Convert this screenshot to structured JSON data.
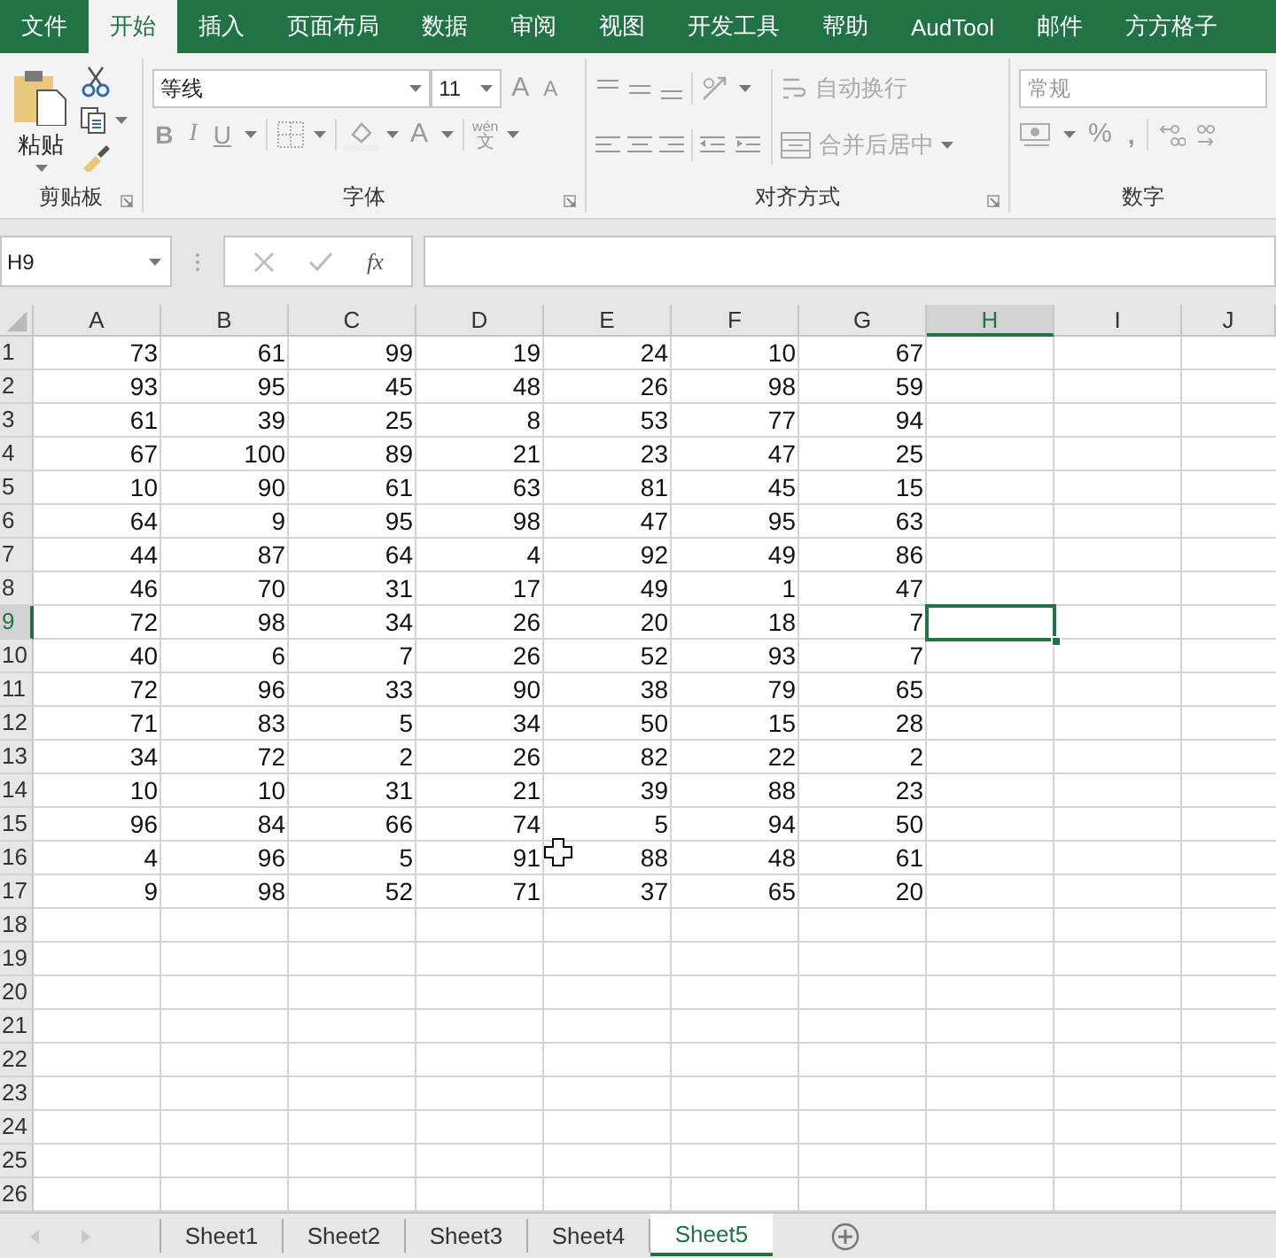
{
  "menu_tabs": [
    {
      "label": "文件",
      "selected": false
    },
    {
      "label": "开始",
      "selected": true
    },
    {
      "label": "插入",
      "selected": false
    },
    {
      "label": "页面布局",
      "selected": false
    },
    {
      "label": "数据",
      "selected": false
    },
    {
      "label": "审阅",
      "selected": false
    },
    {
      "label": "视图",
      "selected": false
    },
    {
      "label": "开发工具",
      "selected": false
    },
    {
      "label": "帮助",
      "selected": false
    },
    {
      "label": "AudTool",
      "selected": false
    },
    {
      "label": "邮件",
      "selected": false
    },
    {
      "label": "方方格子",
      "selected": false
    }
  ],
  "ribbon": {
    "groups": [
      {
        "kind": "clipboard",
        "label": "剪贴板",
        "paste": "粘贴"
      },
      {
        "kind": "font",
        "label": "字体",
        "font": "等线",
        "size": "11",
        "grow": "A",
        "shrink": "A",
        "bold": "B",
        "italic": "I",
        "underline": "U",
        "font_color": "A",
        "phonetic": "wén",
        "phonetic_char": "文"
      },
      {
        "kind": "alignment",
        "label": "对齐方式",
        "wrap": "自动换行",
        "merge": "合并后居中"
      },
      {
        "kind": "number",
        "label": "数字",
        "format": "常规",
        "percent": "%",
        "comma": ","
      }
    ]
  },
  "formula_bar": {
    "name_box": "H9",
    "fx": "fx"
  },
  "columns": [
    {
      "label": "A",
      "selected": false
    },
    {
      "label": "B",
      "selected": false
    },
    {
      "label": "C",
      "selected": false
    },
    {
      "label": "D",
      "selected": false
    },
    {
      "label": "E",
      "selected": false
    },
    {
      "label": "F",
      "selected": false
    },
    {
      "label": "G",
      "selected": false
    },
    {
      "label": "H",
      "selected": true
    },
    {
      "label": "I",
      "selected": false
    },
    {
      "label": "J",
      "selected": false
    }
  ],
  "rows": [
    {
      "label": "1",
      "selected": false,
      "cells": [
        "73",
        "61",
        "99",
        "19",
        "24",
        "10",
        "67"
      ]
    },
    {
      "label": "2",
      "selected": false,
      "cells": [
        "93",
        "95",
        "45",
        "48",
        "26",
        "98",
        "59"
      ]
    },
    {
      "label": "3",
      "selected": false,
      "cells": [
        "61",
        "39",
        "25",
        "8",
        "53",
        "77",
        "94"
      ]
    },
    {
      "label": "4",
      "selected": false,
      "cells": [
        "67",
        "100",
        "89",
        "21",
        "23",
        "47",
        "25"
      ]
    },
    {
      "label": "5",
      "selected": false,
      "cells": [
        "10",
        "90",
        "61",
        "63",
        "81",
        "45",
        "15"
      ]
    },
    {
      "label": "6",
      "selected": false,
      "cells": [
        "64",
        "9",
        "95",
        "98",
        "47",
        "95",
        "63"
      ]
    },
    {
      "label": "7",
      "selected": false,
      "cells": [
        "44",
        "87",
        "64",
        "4",
        "92",
        "49",
        "86"
      ]
    },
    {
      "label": "8",
      "selected": false,
      "cells": [
        "46",
        "70",
        "31",
        "17",
        "49",
        "1",
        "47"
      ]
    },
    {
      "label": "9",
      "selected": true,
      "cells": [
        "72",
        "98",
        "34",
        "26",
        "20",
        "18",
        "7"
      ]
    },
    {
      "label": "10",
      "selected": false,
      "cells": [
        "40",
        "6",
        "7",
        "26",
        "52",
        "93",
        "7"
      ]
    },
    {
      "label": "11",
      "selected": false,
      "cells": [
        "72",
        "96",
        "33",
        "90",
        "38",
        "79",
        "65"
      ]
    },
    {
      "label": "12",
      "selected": false,
      "cells": [
        "71",
        "83",
        "5",
        "34",
        "50",
        "15",
        "28"
      ]
    },
    {
      "label": "13",
      "selected": false,
      "cells": [
        "34",
        "72",
        "2",
        "26",
        "82",
        "22",
        "2"
      ]
    },
    {
      "label": "14",
      "selected": false,
      "cells": [
        "10",
        "10",
        "31",
        "21",
        "39",
        "88",
        "23"
      ]
    },
    {
      "label": "15",
      "selected": false,
      "cells": [
        "96",
        "84",
        "66",
        "74",
        "5",
        "94",
        "50"
      ]
    },
    {
      "label": "16",
      "selected": false,
      "cells": [
        "4",
        "96",
        "5",
        "91",
        "88",
        "48",
        "61"
      ]
    },
    {
      "label": "17",
      "selected": false,
      "cells": [
        "9",
        "98",
        "52",
        "71",
        "37",
        "65",
        "20"
      ]
    },
    {
      "label": "18",
      "selected": false
    },
    {
      "label": "19",
      "selected": false
    },
    {
      "label": "20",
      "selected": false
    },
    {
      "label": "21",
      "selected": false
    },
    {
      "label": "22",
      "selected": false
    },
    {
      "label": "23",
      "selected": false
    },
    {
      "label": "24",
      "selected": false
    },
    {
      "label": "25",
      "selected": false
    },
    {
      "label": "26",
      "selected": false
    }
  ],
  "sheet_tabs": [
    {
      "label": "Sheet1",
      "selected": false
    },
    {
      "label": "Sheet2",
      "selected": false
    },
    {
      "label": "Sheet3",
      "selected": false
    },
    {
      "label": "Sheet4",
      "selected": false
    },
    {
      "label": "Sheet5",
      "selected": true
    }
  ]
}
